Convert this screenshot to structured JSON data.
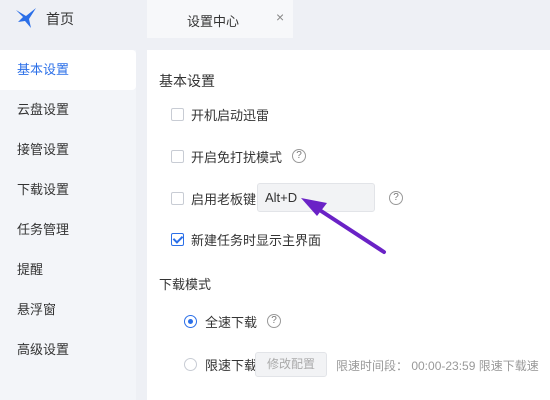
{
  "topbar": {
    "home_label": "首页",
    "settings_tab_label": "设置中心",
    "close_glyph": "×"
  },
  "sidebar": {
    "items": [
      {
        "label": "基本设置",
        "active": true
      },
      {
        "label": "云盘设置"
      },
      {
        "label": "接管设置"
      },
      {
        "label": "下载设置"
      },
      {
        "label": "任务管理"
      },
      {
        "label": "提醒"
      },
      {
        "label": "悬浮窗"
      },
      {
        "label": "高级设置"
      }
    ]
  },
  "main": {
    "section_title": "基本设置",
    "options": {
      "autostart": {
        "label": "开机启动迅雷",
        "checked": false
      },
      "dnd": {
        "label": "开启免打扰模式",
        "checked": false
      },
      "boss_key": {
        "label": "启用老板键",
        "checked": false,
        "hotkey": "Alt+D"
      },
      "show_main": {
        "label": "新建任务时显示主界面",
        "checked": true
      }
    },
    "help_glyph": "?",
    "download_mode": {
      "title": "下载模式",
      "full_speed": {
        "label": "全速下载",
        "selected": true
      },
      "limited": {
        "label": "限速下载",
        "selected": false
      },
      "modify_button": "修改配置",
      "limit_text": "限速时间段：  00:00-23:59  限速下载速"
    }
  },
  "colors": {
    "accent": "#2b6fe8",
    "annotation_arrow": "#6a22c6"
  }
}
